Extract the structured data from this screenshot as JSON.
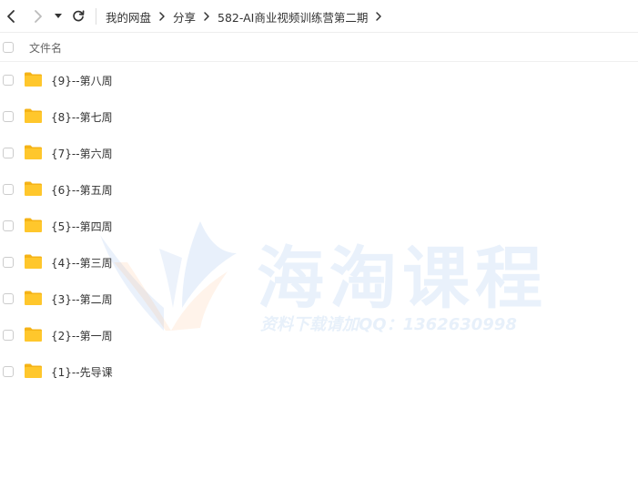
{
  "nav": {
    "back_icon": "back-arrow-icon",
    "forward_icon": "forward-arrow-icon",
    "dropdown_icon": "caret-down-icon",
    "refresh_icon": "refresh-icon"
  },
  "breadcrumb": [
    {
      "label": "我的网盘"
    },
    {
      "label": "分享"
    },
    {
      "label": "582-AI商业视频训练营第二期"
    }
  ],
  "list_header": {
    "column_name": "文件名"
  },
  "files": [
    {
      "name": "{9}--第八周",
      "type": "folder"
    },
    {
      "name": "{8}--第七周",
      "type": "folder"
    },
    {
      "name": "{7}--第六周",
      "type": "folder"
    },
    {
      "name": "{6}--第五周",
      "type": "folder"
    },
    {
      "name": "{5}--第四周",
      "type": "folder"
    },
    {
      "name": "{4}--第三周",
      "type": "folder"
    },
    {
      "name": "{3}--第二周",
      "type": "folder"
    },
    {
      "name": "{2}--第一周",
      "type": "folder"
    },
    {
      "name": "{1}--先导课",
      "type": "folder"
    }
  ],
  "watermark": {
    "main": "海淘课程",
    "sub": "资料下载请加QQ：1362630998"
  },
  "colors": {
    "folder": "#FFC72C",
    "folder_dark": "#F5B316",
    "border": "#EEEEEE",
    "text": "#333333"
  }
}
